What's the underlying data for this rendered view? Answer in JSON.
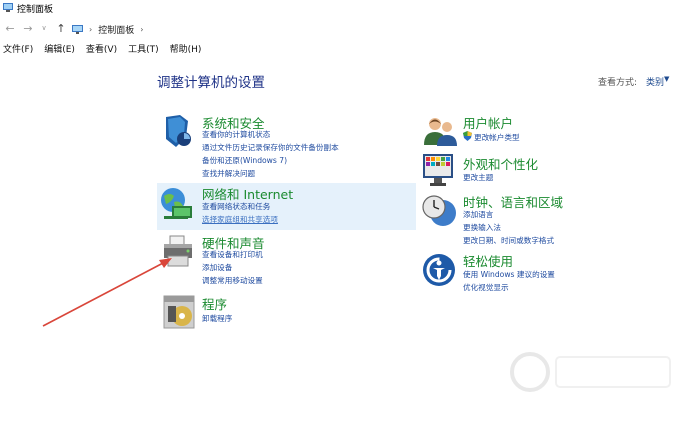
{
  "window": {
    "title": "控制面板"
  },
  "address": {
    "back_icon": "back-arrow-icon",
    "forward_icon": "forward-arrow-icon",
    "up_icon": "up-arrow-icon",
    "breadcrumb": [
      "控制面板"
    ]
  },
  "menu": [
    "文件(F)",
    "编辑(E)",
    "查看(V)",
    "工具(T)",
    "帮助(H)"
  ],
  "page_title": "调整计算机的设置",
  "view_by": {
    "label": "查看方式:",
    "value": "类别"
  },
  "categories": {
    "system": {
      "title": "系统和安全",
      "icon": "shield-icon",
      "links": [
        "查看你的计算机状态",
        "通过文件历史记录保存你的文件备份副本",
        "备份和还原(Windows 7)",
        "查找并解决问题"
      ]
    },
    "network": {
      "title": "网络和 Internet",
      "icon": "globe-network-icon",
      "links": [
        "查看网络状态和任务",
        "选择家庭组和共享选项"
      ]
    },
    "hardware": {
      "title": "硬件和声音",
      "icon": "printer-icon",
      "links": [
        "查看设备和打印机",
        "添加设备",
        "调整常用移动设置"
      ]
    },
    "programs": {
      "title": "程序",
      "icon": "programs-disc-icon",
      "links": [
        "卸载程序"
      ]
    },
    "user": {
      "title": "用户帐户",
      "icon": "users-icon",
      "links": [
        "更改帐户类型"
      ]
    },
    "appearance": {
      "title": "外观和个性化",
      "icon": "monitor-palette-icon",
      "links": [
        "更改主题"
      ]
    },
    "clock": {
      "title": "时钟、语言和区域",
      "icon": "clock-globe-icon",
      "links": [
        "添加语言",
        "更换输入法",
        "更改日期、时间或数字格式"
      ]
    },
    "ease": {
      "title": "轻松使用",
      "icon": "ease-of-access-icon",
      "links": [
        "使用 Windows 建议的设置",
        "优化视觉显示"
      ]
    }
  }
}
